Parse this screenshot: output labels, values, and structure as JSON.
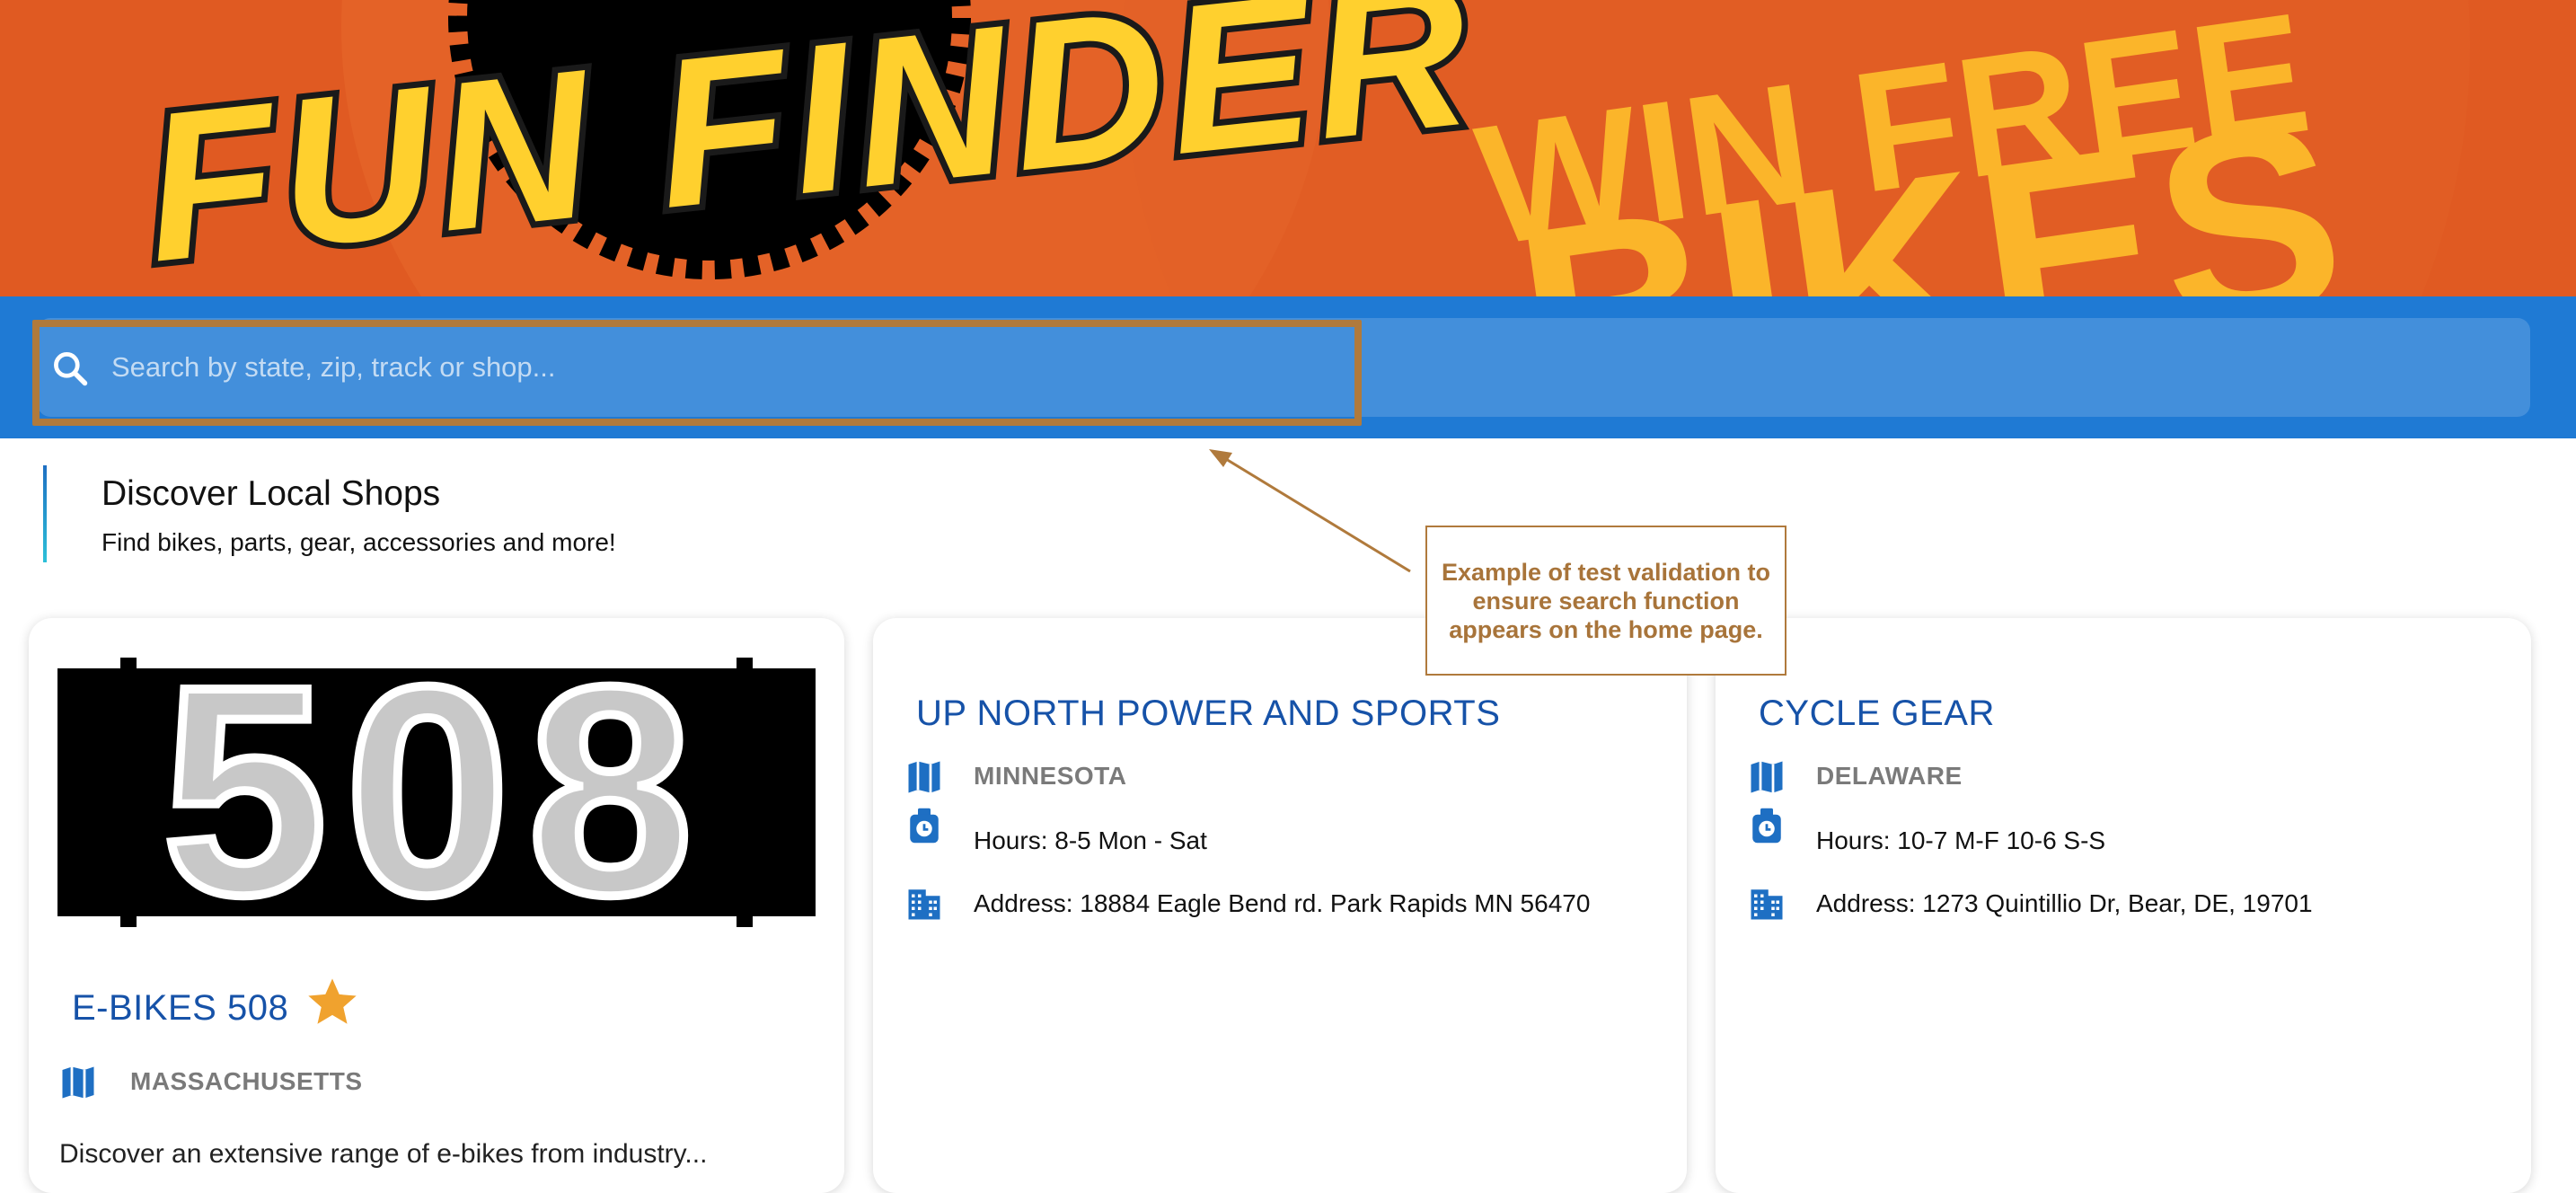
{
  "hero": {
    "logo_text": "FUN FINDER",
    "promo_line1": "WIN FREE",
    "promo_line2": "BIKES"
  },
  "search": {
    "placeholder": "Search by state, zip, track or shop...",
    "icon": "search-icon"
  },
  "section": {
    "title": "Discover Local Shops",
    "subtitle": "Find bikes, parts, gear, accessories and more!"
  },
  "callout": {
    "text": "Example of test validation to ensure search function appears on the home page."
  },
  "shops": [
    {
      "logo_text": "508",
      "name": "E-BIKES 508",
      "state": "MASSACHUSETTS",
      "featured": true,
      "description_partial": "Discover an extensive range of e-bikes from industry..."
    },
    {
      "name": "UP NORTH POWER AND SPORTS",
      "state": "MINNESOTA",
      "hours": "Hours: 8-5 Mon - Sat",
      "address": "Address: 18884 Eagle Bend rd. Park Rapids MN 56470"
    },
    {
      "name": "CYCLE GEAR",
      "state": "DELAWARE",
      "hours": "Hours: 10-7 M-F 10-6 S-S",
      "address": "Address: 1273 Quintillio Dr, Bear, DE, 19701"
    }
  ],
  "colors": {
    "hero_orange": "#e05a22",
    "search_blue": "#1f7ad4",
    "title_blue": "#1652a8",
    "star": "#f0a22e",
    "callout": "#b07a3c"
  }
}
